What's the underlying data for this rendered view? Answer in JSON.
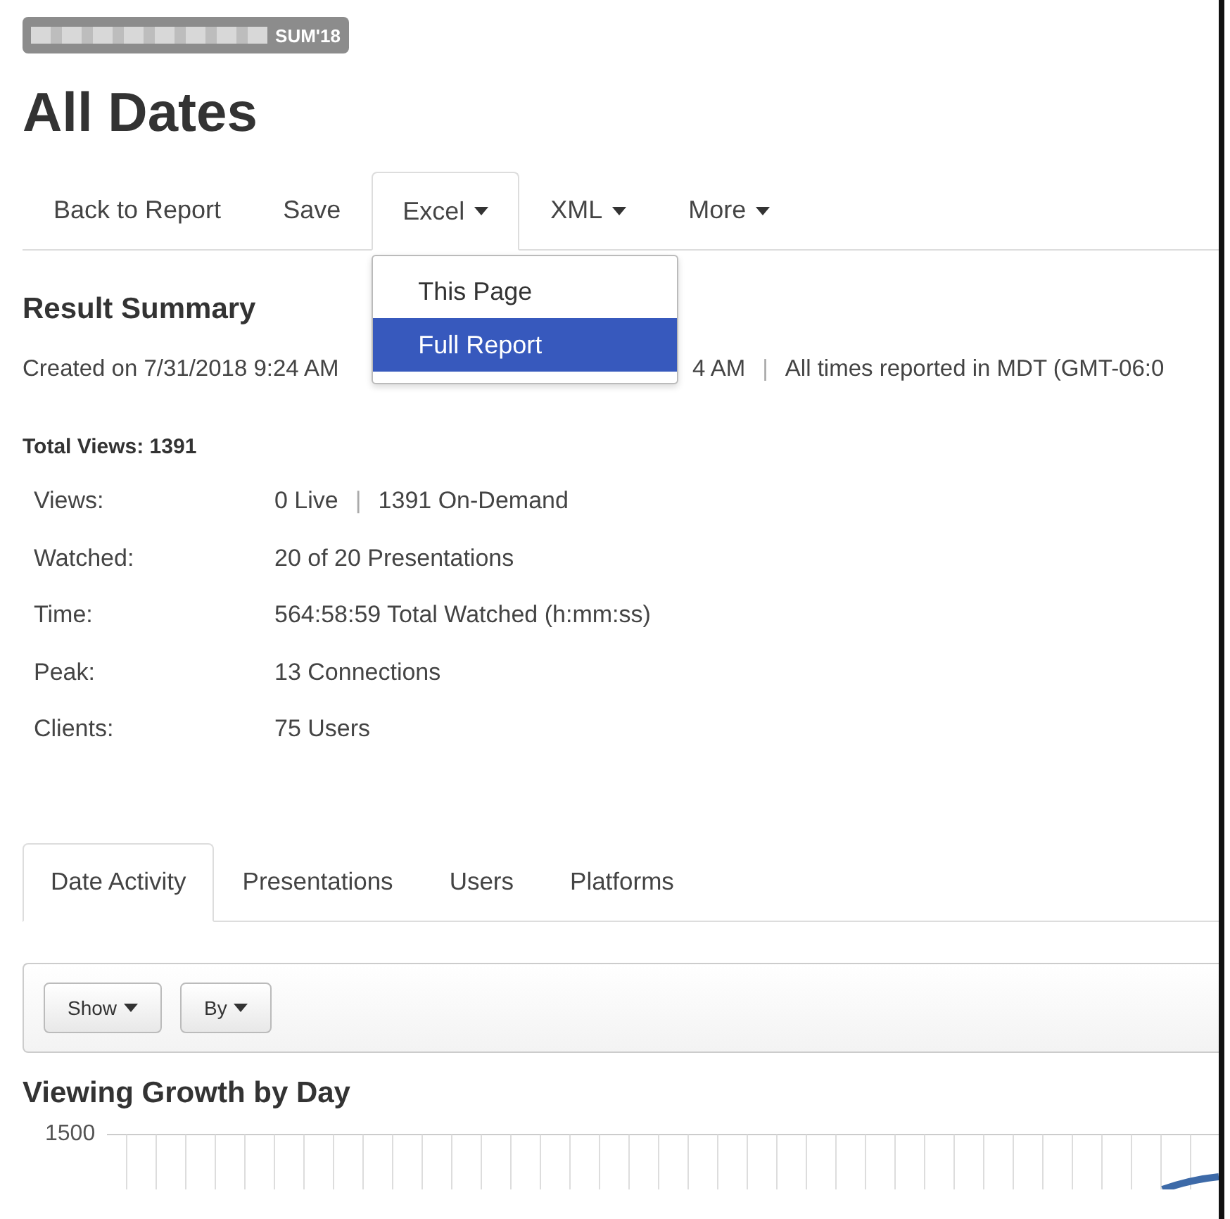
{
  "badge": {
    "label": "SUM'18"
  },
  "title": "All Dates",
  "nav": [
    {
      "label": "Back to Report",
      "dropdown": false,
      "selected": false
    },
    {
      "label": "Save",
      "dropdown": false,
      "selected": false
    },
    {
      "label": "Excel",
      "dropdown": true,
      "selected": true
    },
    {
      "label": "XML",
      "dropdown": true,
      "selected": false
    },
    {
      "label": "More",
      "dropdown": true,
      "selected": false
    }
  ],
  "excel_menu": [
    {
      "label": "This Page",
      "selected": false
    },
    {
      "label": "Full Report",
      "selected": true
    }
  ],
  "summary": {
    "heading": "Result Summary",
    "created": "Created on 7/31/2018 9:24 AM",
    "covered_tail": "4 AM",
    "separator": "|",
    "timezone": "All times reported in MDT (GMT-06:0"
  },
  "total_views": "Total Views: 1391",
  "stats": [
    {
      "label": "Views:",
      "value": "0 Live",
      "extra": "1391 On-Demand"
    },
    {
      "label": "Watched:",
      "value": "20 of 20 Presentations"
    },
    {
      "label": "Time:",
      "value": "564:58:59 Total Watched (h:mm:ss)"
    },
    {
      "label": "Peak:",
      "value": "13 Connections"
    },
    {
      "label": "Clients:",
      "value": "75 Users"
    }
  ],
  "tabs": [
    {
      "label": "Date Activity",
      "selected": true
    },
    {
      "label": "Presentations",
      "selected": false
    },
    {
      "label": "Users",
      "selected": false
    },
    {
      "label": "Platforms",
      "selected": false
    }
  ],
  "toolbar": [
    {
      "label": "Show"
    },
    {
      "label": "By"
    }
  ],
  "chart": {
    "title": "Viewing Growth by Day",
    "top_tick": "1500"
  }
}
